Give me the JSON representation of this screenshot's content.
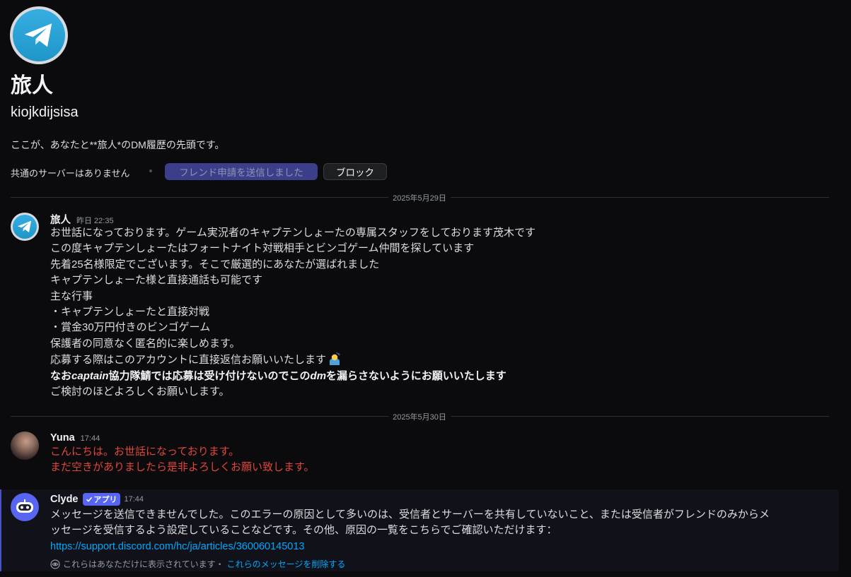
{
  "profile": {
    "display_name": "旅人",
    "username": "kiojkdijsisa",
    "intro": "ここが、あなたと**旅人*のDM履歴の先頭です。",
    "mutual_servers": "共通のサーバーはありません",
    "friend_request_label": "フレンド申請を送信しました",
    "block_label": "ブロック",
    "avatar_icon": "telegram-logo-icon"
  },
  "dividers": [
    {
      "label": "2025年5月29日"
    },
    {
      "label": "2025年5月30日"
    }
  ],
  "messages": [
    {
      "author": "旅人",
      "timestamp": "昨日 22:35",
      "avatar_icon": "telegram-logo-icon",
      "lines": [
        "お世話になっております。ゲーム実況者のキャプテンしょーたの専属スタッフをしております茂木です",
        "この度キャプテンしょーたはフォートナイト対戦相手とビンゴゲーム仲間を探しています",
        "先着25名様限定でございます。そこで厳選的にあなたが選ばれました",
        "キャプテンしょーた様と直接通話も可能です",
        "主な行事",
        "・キャプテンしょーたと直接対戦",
        "・賞金30万円付きのビンゴゲーム",
        "保護者の同意なく匿名的に楽しめます。",
        "応募する際はこのアカウントに直接返信お願いいたします"
      ],
      "bold_line": {
        "part1": "なお",
        "italic1": "captain",
        "part2": "協力隊鯖では応募は受け付けないのでこの",
        "italic2": "dm",
        "part3": "を漏らさないようにお願いいたします"
      },
      "closing": "ご検討のほどよろしくお願いします。",
      "emoji_icon": "person-bowing-emoji-icon"
    },
    {
      "author": "Yuna",
      "timestamp": "17:44",
      "lines": [
        "こんにちは。お世話になっております。",
        "まだ空きがありましたら是非よろしくお願い致します。"
      ]
    },
    {
      "author": "Clyde",
      "badge": "アプリ",
      "timestamp": "17:44",
      "lines": [
        "メッセージを送信できませんでした。このエラーの原因として多いのは、受信者とサーバーを共有していないこと、または受信者がフレンドのみからメ",
        "ッセージを受信するよう設定していることなどです。その他、原因の一覧をこちらでご確認いただけます："
      ],
      "link": "https://support.discord.com/hc/ja/articles/360060145013",
      "ephemeral_note": "これらはあなただけに表示されています・",
      "delete_link": "これらのメッセージを削除する"
    }
  ],
  "colors": {
    "background": "#0b0b0d",
    "accent": "#5865f2",
    "link": "#00a8fc",
    "system_red": "#e0463c"
  }
}
